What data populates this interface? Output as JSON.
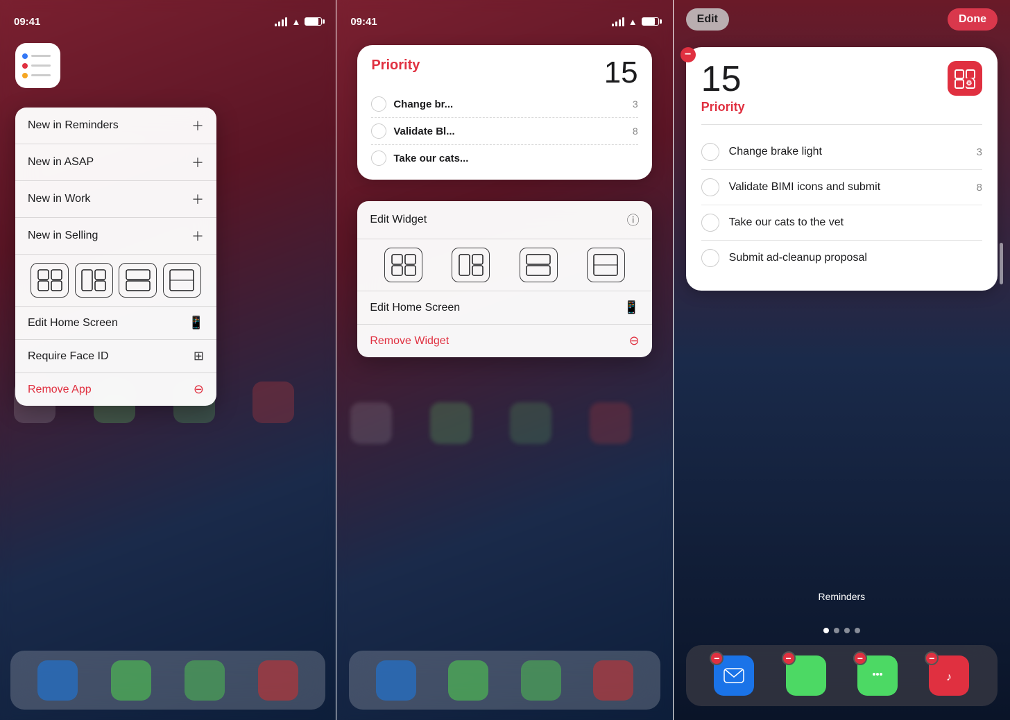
{
  "panel1": {
    "status_time": "09:41",
    "app_icon_label": "Reminders",
    "menu_items": [
      {
        "label": "New in Reminders",
        "icon": "+"
      },
      {
        "label": "New in ASAP",
        "icon": "+"
      },
      {
        "label": "New in Work",
        "icon": "+"
      },
      {
        "label": "New in Selling",
        "icon": "+"
      }
    ],
    "edit_home_screen": "Edit Home Screen",
    "require_face_id": "Require Face ID",
    "remove_app": "Remove App"
  },
  "panel2": {
    "status_time": "09:41",
    "widget": {
      "title": "Priority",
      "count": "15",
      "tasks": [
        {
          "name": "Change br...",
          "count": "3"
        },
        {
          "name": "Validate Bl...",
          "count": "8"
        },
        {
          "name": "Take our cats...",
          "count": ""
        }
      ]
    },
    "context_menu": {
      "edit_widget": "Edit Widget",
      "edit_home_screen": "Edit Home Screen",
      "remove_widget": "Remove Widget"
    }
  },
  "panel3": {
    "status_time": "09:41",
    "btn_edit": "Edit",
    "btn_done": "Done",
    "widget": {
      "count": "15",
      "label": "Priority",
      "tasks": [
        {
          "name": "Change brake light",
          "count": "3"
        },
        {
          "name": "Validate BIMI icons and submit",
          "count": "8"
        },
        {
          "name": "Take our cats to the vet",
          "count": ""
        },
        {
          "name": "Submit ad-cleanup proposal",
          "count": ""
        }
      ]
    },
    "reminders_label": "Reminders",
    "dock": [
      {
        "icon": "✉️",
        "color": "#1a73e8"
      },
      {
        "icon": "📞",
        "color": "#4cd964"
      },
      {
        "icon": "💬",
        "color": "#4cd964"
      },
      {
        "icon": "🎵",
        "color": "#e03040"
      }
    ]
  }
}
